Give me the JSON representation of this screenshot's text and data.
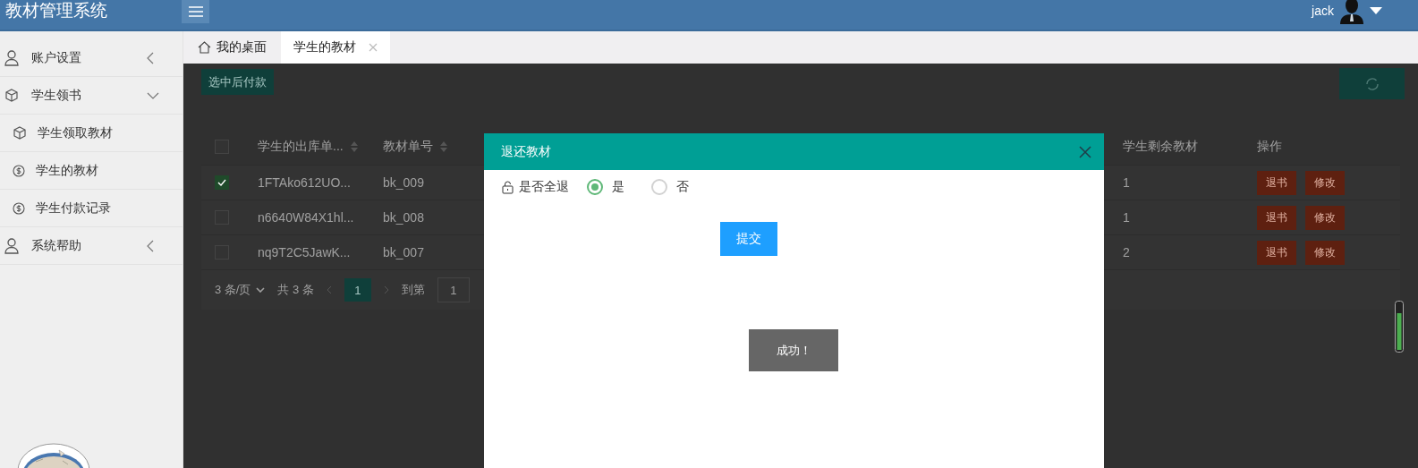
{
  "header": {
    "title": "教材管理系统",
    "user": "jack"
  },
  "sidebar": {
    "items": [
      {
        "label": "账户设置",
        "expanded": false
      },
      {
        "label": "学生领书",
        "expanded": true,
        "children": [
          {
            "label": "学生领取教材"
          },
          {
            "label": "学生的教材"
          },
          {
            "label": "学生付款记录"
          }
        ]
      },
      {
        "label": "系统帮助",
        "expanded": false
      }
    ]
  },
  "tabs": [
    {
      "label": "我的桌面",
      "selected": false,
      "closable": false
    },
    {
      "label": "学生的教材",
      "selected": true,
      "closable": true
    }
  ],
  "toolbar": {
    "pay_button": "选中后付款"
  },
  "table": {
    "header_checked": false,
    "columns": [
      {
        "label": "学生的出库单...",
        "sortable": true
      },
      {
        "label": "教材单号",
        "sortable": true
      },
      {
        "label": "学生剩余教材",
        "sortable": false
      },
      {
        "label": "操作",
        "sortable": false
      }
    ],
    "rows": [
      {
        "checked": true,
        "cells": [
          "1FTAko612UO...",
          "bk_009",
          "1"
        ],
        "actions": [
          "退书",
          "修改"
        ]
      },
      {
        "checked": false,
        "cells": [
          "n6640W84X1hl...",
          "bk_008",
          "1"
        ],
        "actions": [
          "退书",
          "修改"
        ]
      },
      {
        "checked": false,
        "cells": [
          "nq9T2C5JawK...",
          "bk_007",
          "2"
        ],
        "actions": [
          "退书",
          "修改"
        ]
      }
    ]
  },
  "pagination": {
    "page_size": "3 条/页",
    "total": "共 3 条",
    "pages": [
      {
        "label": "1",
        "selected": true
      }
    ],
    "goto_label": "到第",
    "goto_value": "1"
  },
  "dialog": {
    "title": "退还教材",
    "field_label": "是否全退",
    "options": [
      {
        "label": "是",
        "selected": true
      },
      {
        "label": "否",
        "selected": false
      }
    ],
    "submit": "提交"
  },
  "toast": "成功！"
}
